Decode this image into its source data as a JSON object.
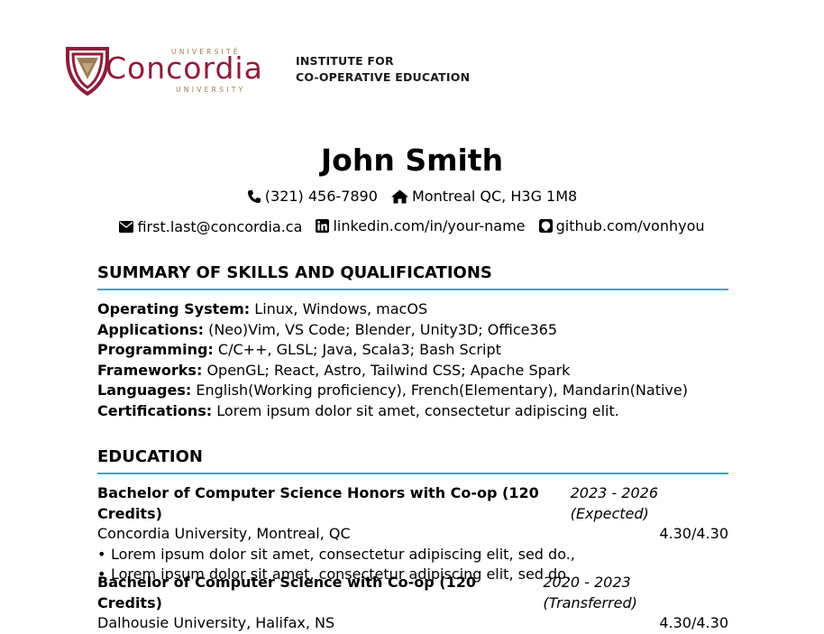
{
  "header": {
    "university_top": "UNIVERSITÉ",
    "university_name": "Concordia",
    "university_bottom": "UNIVERSITY",
    "institute_line1": "INSTITUTE FOR",
    "institute_line2": "CO-OPERATIVE EDUCATION"
  },
  "person": {
    "name": "John Smith",
    "phone": "(321) 456-7890",
    "address": "Montreal QC, H3G 1M8",
    "email": "first.last@concordia.ca",
    "linkedin": "linkedin.com/in/your-name",
    "github": "github.com/vonhyou"
  },
  "summary": {
    "title": "SUMMARY OF SKILLS AND QUALIFICATIONS",
    "items": [
      {
        "label": "Operating System:",
        "value": "Linux, Windows, macOS"
      },
      {
        "label": "Applications:",
        "value": "(Neo)Vim, VS Code; Blender, Unity3D; Office365"
      },
      {
        "label": "Programming:",
        "value": "C/C++, GLSL; Java, Scala3; Bash Script"
      },
      {
        "label": "Frameworks:",
        "value": "OpenGL; React, Astro, Tailwind CSS; Apache Spark"
      },
      {
        "label": "Languages:",
        "value": "English(Working proficiency), French(Elementary), Mandarin(Native)"
      },
      {
        "label": "Certifications:",
        "value": "Lorem ipsum dolor sit amet, consectetur adipiscing elit."
      }
    ]
  },
  "education": {
    "title": "EDUCATION",
    "entries": [
      {
        "degree": "Bachelor of Computer Science Honors with Co-op (120 Credits)",
        "dates": "2023 - 2026 (Expected)",
        "school": "Concordia University, Montreal, QC",
        "gpa": "4.30/4.30",
        "bullets": [
          "Lorem ipsum dolor sit amet, consectetur adipiscing elit, sed do.,",
          "Lorem ipsum dolor sit amet, consectetur adipiscing elit, sed do."
        ]
      },
      {
        "degree": "Bachelor of Computer Science with Co-op (120 Credits)",
        "dates": "2020 - 2023 (Transferred)",
        "school": "Dalhousie University, Halifax, NS",
        "gpa": "4.30/4.30"
      }
    ]
  },
  "colors": {
    "accent_rule": "#2aa3e0",
    "concordia_burgundy": "#8f1d3a",
    "concordia_gold": "#9b7b52"
  }
}
